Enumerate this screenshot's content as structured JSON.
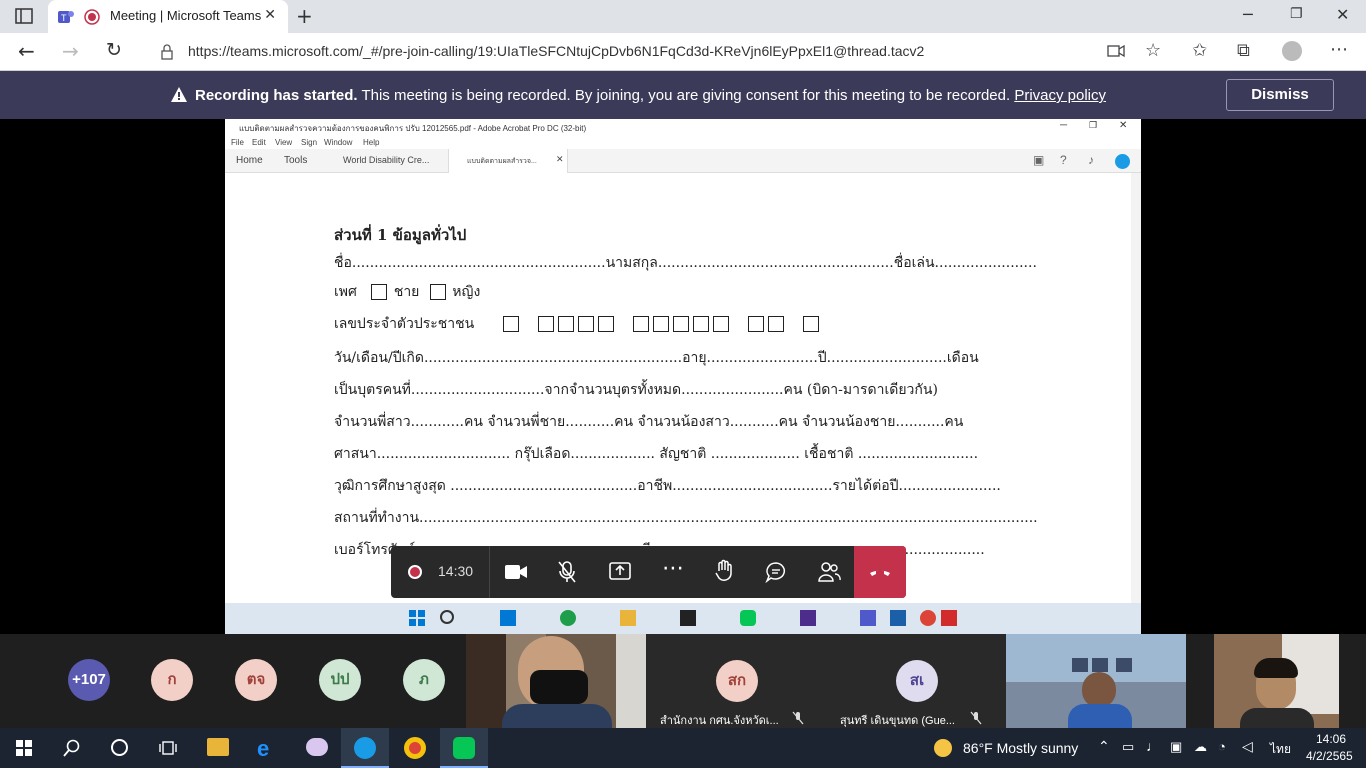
{
  "browser": {
    "tab_title": "Meeting | Microsoft Teams",
    "url": "https://teams.microsoft.com/_#/pre-join-calling/19:UIaTleSFCNtujCpDvb6N1FqCd3d-KReVjn6lEyPpxEl1@thread.tacv2"
  },
  "banner": {
    "strong": "Recording has started.",
    "text": " This meeting is being recorded. By joining, you are giving consent for this meeting to be recorded. ",
    "link": "Privacy policy",
    "dismiss": "Dismiss"
  },
  "acrobat": {
    "title": "แบบติดตามผลสำรวจความต้องการของคนพิการ ปรับ 12012565.pdf - Adobe Acrobat Pro DC (32-bit)",
    "menu": [
      "File",
      "Edit",
      "View",
      "Sign",
      "Window",
      "Help"
    ],
    "tabs": [
      "Home",
      "Tools",
      "World Disability Cre...",
      "แบบติดตามผลสำรวจ..."
    ]
  },
  "document": {
    "heading": "ส่วนที่ 1  ข้อมูลทั่วไป",
    "line1": "ชื่อ.........................................................นามสกุล.....................................................ชื่อเล่น.......................",
    "gender_label": "เพศ",
    "male": "ชาย",
    "female": "หญิง",
    "id_label": "เลขประจำตัวประชาชน",
    "line_dob": "วัน/เดือน/ปีเกิด..........................................................อายุ.........................ปี...........................เดือน",
    "line_child": "เป็นบุตรคนที่..............................จากจำนวนบุตรทั้งหมด.......................คน (บิดา-มารดาเดียวกัน)",
    "line_sib": "จำนวนพี่สาว............คน จำนวนพี่ชาย...........คน จำนวนน้องสาว...........คน จำนวนน้องชาย...........คน",
    "line_rel": "ศาสนา..............................   กรุ๊ปเลือด...................   สัญชาติ ....................   เชื้อชาติ ...........................",
    "line_edu": "วุฒิการศึกษาสูงสุด ..........................................อาชีพ....................................รายได้ต่อปี.......................",
    "line_work": "สถานที่ทำงาน...........................................................................................................................................",
    "line_tel": "เบอร์โทรศัพท์...................................................อีเมล......................................................................"
  },
  "controls": {
    "timer": "14:30"
  },
  "participants": {
    "overflow": "+107",
    "avatars": [
      {
        "initials": "ก",
        "bg": "#f3d0c7",
        "fg": "#a0413a"
      },
      {
        "initials": "ตจ",
        "bg": "#f3d0c7",
        "fg": "#a0413a"
      },
      {
        "initials": "ปป",
        "bg": "#cfe7d4",
        "fg": "#3d7a4a"
      },
      {
        "initials": "ภ",
        "bg": "#cfe7d4",
        "fg": "#3d7a4a"
      }
    ],
    "tile1_initials": "สก",
    "tile1_name": "สำนักงาน กศน.จังหวัดเ...",
    "tile2_initials": "สเ",
    "tile2_name": "สุนทรี เดินขุนทด (Gue..."
  },
  "taskbar": {
    "weather": "86°F  Mostly sunny",
    "lang": "ไทย",
    "time": "14:06",
    "date": "4/2/2565"
  }
}
